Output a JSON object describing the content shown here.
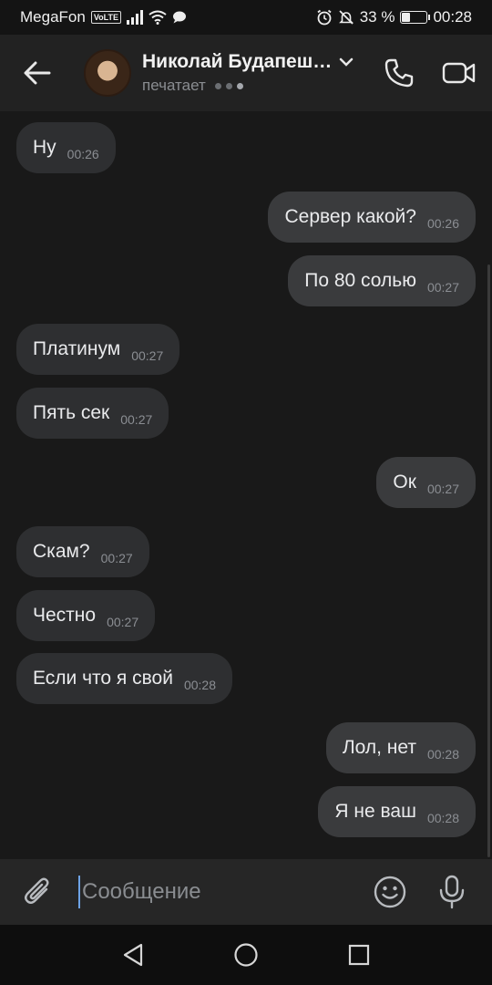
{
  "status_bar": {
    "carrier": "MegaFon",
    "volte": "VoLTE",
    "battery": "33 %",
    "time": "00:28",
    "battery_level": 0.33
  },
  "header": {
    "chat_name": "Николай Будапеш…",
    "status_text": "печатает"
  },
  "messages": [
    {
      "text": "Ну",
      "time": "00:26",
      "dir": "in"
    },
    {
      "text": "Сервер какой?",
      "time": "00:26",
      "dir": "out"
    },
    {
      "text": "По 80 солью",
      "time": "00:27",
      "dir": "out"
    },
    {
      "text": "Платинум",
      "time": "00:27",
      "dir": "in"
    },
    {
      "text": "Пять сек",
      "time": "00:27",
      "dir": "in"
    },
    {
      "text": "Ок",
      "time": "00:27",
      "dir": "out"
    },
    {
      "text": "Скам?",
      "time": "00:27",
      "dir": "in"
    },
    {
      "text": "Честно",
      "time": "00:27",
      "dir": "in"
    },
    {
      "text": "Если что я свой",
      "time": "00:28",
      "dir": "in"
    },
    {
      "text": "Лол, нет",
      "time": "00:28",
      "dir": "out"
    },
    {
      "text": "Я не ваш",
      "time": "00:28",
      "dir": "out"
    }
  ],
  "composer": {
    "placeholder": "Сообщение"
  },
  "icons": {
    "back": "arrow-left-icon",
    "call": "phone-icon",
    "video": "video-camera-icon",
    "attach": "paperclip-icon",
    "emoji": "smile-icon",
    "mic": "microphone-icon"
  }
}
